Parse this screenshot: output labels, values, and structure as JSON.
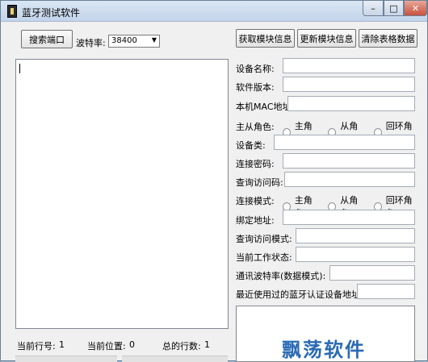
{
  "window": {
    "title": "蓝牙测试软件",
    "controls": {
      "minimize": "–",
      "maximize": "□",
      "close": "✕"
    }
  },
  "toolbar": {
    "search_button": "搜索端口",
    "baud_label": "波特率:",
    "baud_value": "38400",
    "get_info_button": "获取模块信息",
    "update_info_button": "更新模块信息",
    "clear_table_button": "清除表格数据"
  },
  "form": {
    "device_name": "设备名称:",
    "software_version": "软件版本:",
    "local_mac": "本机MAC地址:",
    "role_label": "主从角色:",
    "role_options": [
      "主角色",
      "从角色",
      "回环角色"
    ],
    "device_class": "设备类:",
    "pin_code": "连接密码:",
    "inquiry_code": "查询访问码:",
    "connect_mode_label": "连接模式:",
    "connect_mode_options": [
      "主角色",
      "从角色",
      "回环角色"
    ],
    "bind_address": "绑定地址:",
    "inquiry_mode": "查询访问模式:",
    "work_state": "当前工作状态:",
    "comm_baud": "通讯波特率(数据模式):",
    "last_paired": "最近使用过的蓝牙认证设备地址:"
  },
  "status": {
    "current_line_label": "当前行号:",
    "current_line_value": "1",
    "current_pos_label": "当前位置:",
    "current_pos_value": "0",
    "total_lines_label": "总的行数:",
    "total_lines_value": "1"
  },
  "watermark": "飘荡软件"
}
